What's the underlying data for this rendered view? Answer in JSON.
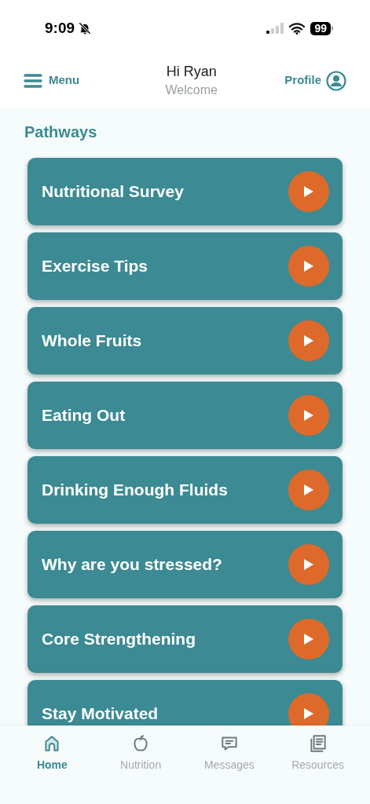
{
  "status_bar": {
    "time": "9:09",
    "battery": "99"
  },
  "header": {
    "menu": "Menu",
    "greeting": "Hi Ryan",
    "subtitle": "Welcome",
    "profile": "Profile"
  },
  "section_title": "Pathways",
  "pathways": [
    {
      "title": "Nutritional Survey"
    },
    {
      "title": "Exercise Tips"
    },
    {
      "title": "Whole Fruits"
    },
    {
      "title": "Eating Out"
    },
    {
      "title": "Drinking Enough Fluids"
    },
    {
      "title": "Why are you stressed?"
    },
    {
      "title": "Core Strengthening"
    },
    {
      "title": "Stay Motivated"
    }
  ],
  "tab_bar": [
    {
      "label": "Home",
      "kind": "home",
      "selected": true
    },
    {
      "label": "Nutrition",
      "kind": "nutrition",
      "selected": false
    },
    {
      "label": "Messages",
      "kind": "messages",
      "selected": false
    },
    {
      "label": "Resources",
      "kind": "resources",
      "selected": false
    }
  ]
}
